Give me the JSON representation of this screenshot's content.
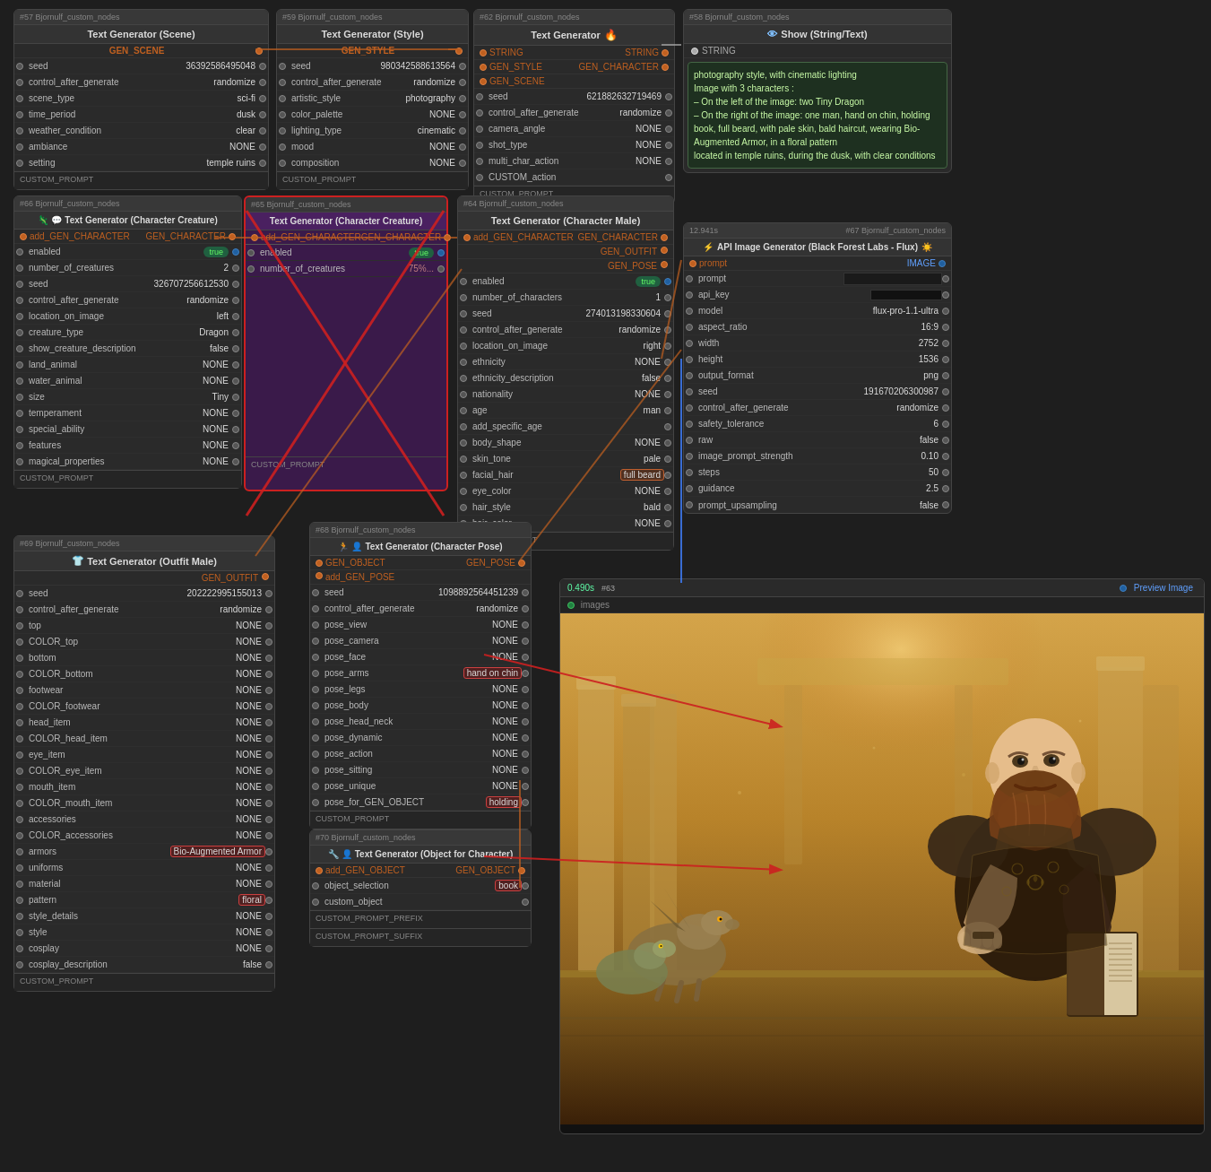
{
  "nodes": {
    "n57": {
      "id": "#57 Bjornulf_custom_nodes",
      "title": "Text Generator (Scene)",
      "section": "GEN_SCENE",
      "fields": [
        {
          "label": "seed",
          "value": "36392586495048"
        },
        {
          "label": "control_after_generate",
          "value": "randomize"
        },
        {
          "label": "scene_type",
          "value": "sci-fi"
        },
        {
          "label": "time_period",
          "value": "dusk"
        },
        {
          "label": "weather_condition",
          "value": "clear"
        },
        {
          "label": "ambiance",
          "value": "NONE"
        },
        {
          "label": "setting",
          "value": "temple ruins"
        }
      ]
    },
    "n59": {
      "id": "#59 Bjornulf_custom_nodes",
      "title": "Text Generator (Style)",
      "section": "GEN_STYLE",
      "fields": [
        {
          "label": "seed",
          "value": "980342588613564"
        },
        {
          "label": "control_after_generate",
          "value": "randomize"
        },
        {
          "label": "artistic_style",
          "value": "photography"
        },
        {
          "label": "color_palette",
          "value": "NONE"
        },
        {
          "label": "lighting_type",
          "value": "cinematic"
        },
        {
          "label": "mood",
          "value": "NONE"
        },
        {
          "label": "composition",
          "value": "NONE"
        }
      ]
    },
    "n62": {
      "id": "#62 Bjornulf_custom_nodes",
      "title": "Text Generator",
      "outputs": [
        "GEN_CHARACTER",
        "GEN_SCENE"
      ],
      "inputs": [
        "STRING",
        "GEN_STYLE",
        "GEN_SCENE"
      ],
      "fields": [
        {
          "label": "seed",
          "value": "621882632719469"
        },
        {
          "label": "control_after_generate",
          "value": "randomize"
        },
        {
          "label": "camera_angle",
          "value": "NONE"
        },
        {
          "label": "shot_type",
          "value": "NONE"
        },
        {
          "label": "multi_char_action",
          "value": "NONE"
        },
        {
          "label": "CUSTOM_action",
          "value": ""
        }
      ]
    },
    "n58": {
      "id": "#58 Bjornulf_custom_nodes",
      "title": "Show (String/Text)",
      "text": "photography style, with cinematic lighting\nImage with 3 characters :\n– On the left of the image: two Tiny Dragon\n– On the right of the image: one man, hand on chin, holding book, full beard, with pale skin, bald haircut, wearing Bio-Augmented Armor, in a floral pattern\nlocated in temple ruins, during the dusk, with clear conditions"
    },
    "n66": {
      "id": "#66 Bjornulf_custom_nodes",
      "title": "Text Generator (Character Creature)",
      "outputs_left": [
        "add_GEN_CHARACTER"
      ],
      "outputs_right": [
        "GEN_CHARACTER"
      ],
      "fields": [
        {
          "label": "enabled",
          "value": "true"
        },
        {
          "label": "number_of_creatures",
          "value": "2"
        },
        {
          "label": "seed",
          "value": "326707256612530"
        },
        {
          "label": "control_after_generate",
          "value": "randomize"
        },
        {
          "label": "location_on_image",
          "value": "left"
        },
        {
          "label": "creature_type",
          "value": "Dragon"
        },
        {
          "label": "show_creature_description",
          "value": "false"
        },
        {
          "label": "land_animal",
          "value": "NONE"
        },
        {
          "label": "water_animal",
          "value": "NONE"
        },
        {
          "label": "size",
          "value": "Tiny"
        },
        {
          "label": "temperament",
          "value": "NONE"
        },
        {
          "label": "special_ability",
          "value": "NONE"
        },
        {
          "label": "features",
          "value": "NONE"
        },
        {
          "label": "magical_properties",
          "value": "NONE"
        }
      ]
    },
    "n65": {
      "id": "#65 Bjornulf_custom_nodes",
      "title": "Text Generator (Character Creature)",
      "highlighted": true
    },
    "n64": {
      "id": "#64 Bjornulf_custom_nodes",
      "title": "Text Generator (Character Male)",
      "outputs_left": [
        "add_GEN_CHARACTER"
      ],
      "outputs_right": [
        "GEN_CHARACTER"
      ],
      "fields_top": [
        {
          "label": "enabled",
          "value": "true"
        },
        {
          "label": "number_of_characters",
          "value": "1"
        },
        {
          "label": "seed",
          "value": "274013198330604"
        },
        {
          "label": "control_after_generate",
          "value": "randomize"
        },
        {
          "label": "location_on_image",
          "value": "right"
        },
        {
          "label": "ethnicity",
          "value": "NONE"
        },
        {
          "label": "ethnicity_description",
          "value": "false"
        },
        {
          "label": "nationality",
          "value": "NONE"
        },
        {
          "label": "age",
          "value": "man"
        },
        {
          "label": "add_specific_age",
          "value": ""
        },
        {
          "label": "body_shape",
          "value": "NONE"
        },
        {
          "label": "skin_tone",
          "value": "pale"
        },
        {
          "label": "facial_hair",
          "value": "full beard"
        },
        {
          "label": "eye_color",
          "value": "NONE"
        },
        {
          "label": "hair_style",
          "value": "bald"
        },
        {
          "label": "hair_color",
          "value": "NONE"
        }
      ]
    },
    "n67": {
      "id": "#67 Bjornulf_custom_nodes",
      "title": "API Image Generator (Black Forest Labs - Flux)",
      "timing": "12.941s",
      "fields": [
        {
          "label": "prompt",
          "value": ""
        },
        {
          "label": "api_key",
          "value": ""
        },
        {
          "label": "model",
          "value": "flux-pro-1.1-ultra"
        },
        {
          "label": "aspect_ratio",
          "value": "16:9"
        },
        {
          "label": "width",
          "value": "2752"
        },
        {
          "label": "height",
          "value": "1536"
        },
        {
          "label": "output_format",
          "value": "png"
        },
        {
          "label": "seed",
          "value": "191670206300987"
        },
        {
          "label": "control_after_generate",
          "value": "randomize"
        },
        {
          "label": "safety_tolerance",
          "value": "6"
        },
        {
          "label": "raw",
          "value": "false"
        },
        {
          "label": "image_prompt_strength",
          "value": "0.10"
        },
        {
          "label": "steps",
          "value": "50"
        },
        {
          "label": "guidance",
          "value": "2.5"
        },
        {
          "label": "prompt_upsampling",
          "value": "false"
        }
      ],
      "output": "IMAGE"
    },
    "n68": {
      "id": "#68 Bjornulf_custom_nodes",
      "title": "Text Generator (Character Pose)",
      "outputs_left": [
        "GEN_OBJECT",
        "add_GEN_POSE"
      ],
      "outputs_right": [
        "GEN_POSE"
      ],
      "fields": [
        {
          "label": "seed",
          "value": "1098892564451239"
        },
        {
          "label": "control_after_generate",
          "value": "randomize"
        },
        {
          "label": "pose_view",
          "value": "NONE"
        },
        {
          "label": "pose_camera",
          "value": "NONE"
        },
        {
          "label": "pose_face",
          "value": "NONE"
        },
        {
          "label": "pose_arms",
          "value": "hand on chin"
        },
        {
          "label": "pose_legs",
          "value": "NONE"
        },
        {
          "label": "pose_body",
          "value": "NONE"
        },
        {
          "label": "pose_head_neck",
          "value": "NONE"
        },
        {
          "label": "pose_dynamic",
          "value": "NONE"
        },
        {
          "label": "pose_action",
          "value": "NONE"
        },
        {
          "label": "pose_sitting",
          "value": "NONE"
        },
        {
          "label": "pose_unique",
          "value": "NONE"
        },
        {
          "label": "pose_for_GEN_OBJECT",
          "value": "holding"
        }
      ]
    },
    "n69": {
      "id": "#69 Bjornulf_custom_nodes",
      "title": "Text Generator (Outfit Male)",
      "output": "GEN_OUTFIT",
      "fields": [
        {
          "label": "seed",
          "value": "202222995155013"
        },
        {
          "label": "control_after_generate",
          "value": "randomize"
        },
        {
          "label": "top",
          "value": "NONE"
        },
        {
          "label": "COLOR_top",
          "value": "NONE"
        },
        {
          "label": "bottom",
          "value": "NONE"
        },
        {
          "label": "COLOR_bottom",
          "value": "NONE"
        },
        {
          "label": "footwear",
          "value": "NONE"
        },
        {
          "label": "COLOR_footwear",
          "value": "NONE"
        },
        {
          "label": "head_item",
          "value": "NONE"
        },
        {
          "label": "COLOR_head_item",
          "value": "NONE"
        },
        {
          "label": "eye_item",
          "value": "NONE"
        },
        {
          "label": "COLOR_eye_item",
          "value": "NONE"
        },
        {
          "label": "mouth_item",
          "value": "NONE"
        },
        {
          "label": "COLOR_mouth_item",
          "value": "NONE"
        },
        {
          "label": "accessories",
          "value": "NONE"
        },
        {
          "label": "COLOR_accessories",
          "value": "NONE"
        },
        {
          "label": "armors",
          "value": "Bio-Augmented Armor",
          "highlight": true
        },
        {
          "label": "uniforms",
          "value": "NONE"
        },
        {
          "label": "material",
          "value": "NONE"
        },
        {
          "label": "pattern",
          "value": "floral",
          "highlight": true
        },
        {
          "label": "style_details",
          "value": "NONE"
        },
        {
          "label": "style",
          "value": "NONE"
        },
        {
          "label": "cosplay",
          "value": "NONE"
        },
        {
          "label": "cosplay_description",
          "value": "false"
        }
      ]
    },
    "n70": {
      "id": "#70 Bjornulf_custom_nodes",
      "title": "Text Generator (Object for Character)",
      "output": "GEN_OBJECT",
      "fields": [
        {
          "label": "add_GEN_OBJECT",
          "value": ""
        },
        {
          "label": "object_selection",
          "value": "book",
          "highlight": true
        },
        {
          "label": "custom_object",
          "value": ""
        }
      ],
      "bottom_fields": [
        {
          "label": "CUSTOM_PROMPT_PREFIX",
          "value": ""
        },
        {
          "label": "CUSTOM_PROMPT_SUFFIX",
          "value": ""
        }
      ]
    },
    "n63": {
      "id": "#63",
      "timing": "0.490s"
    },
    "preview": {
      "id": "Preview Image",
      "sub": "images",
      "timing": ""
    }
  },
  "ui": {
    "colors": {
      "background": "#1e1e1e",
      "node_bg": "#2a2a2a",
      "node_border": "#444",
      "header_bg": "#383838",
      "section_green": "#208040",
      "section_orange": "#804020",
      "accent_purple": "#4a2060",
      "connector_orange": "#c06020",
      "connector_green": "#208040",
      "text_green_display": "#ccffaa",
      "text_display_bg": "#1e3020",
      "text_display_border": "#446644"
    }
  }
}
